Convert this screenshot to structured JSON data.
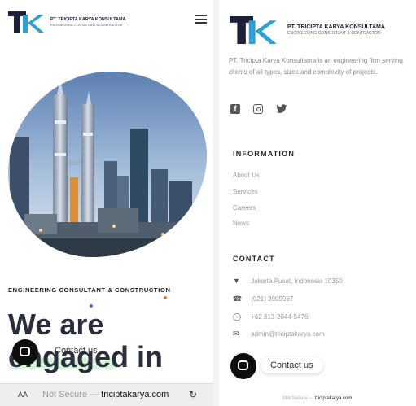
{
  "left": {
    "logo": {
      "mark": "TK",
      "brand": "PT. TRICIPTA KARYA KONSULTAMA",
      "tagline": "ENGINEERING CONSULTANT & CONTRACTOR"
    },
    "hero": {
      "subtitle": "ENGINEERING CONSULTANT & CONSTRUCTION",
      "headline_line1": "We are",
      "headline_line2": "engaged in"
    },
    "chat": {
      "label": "Contact us"
    },
    "address_bar": {
      "text_size": "AA",
      "security": "Not Secure",
      "separator": "—",
      "domain": "triciptakarya.com",
      "reload_icon": "reload-icon"
    }
  },
  "right": {
    "logo": {
      "mark": "TK",
      "brand": "PT. TRICIPTA KARYA KONSULTAMA",
      "tagline": "ENGINEERING CONSULTANT & CONTRACTOR"
    },
    "description": "PT. Tricipta Karya Konsultama is an engineering firm serving clients of all types, sizes and complexity of projects.",
    "social": [
      "facebook-icon",
      "instagram-icon",
      "twitter-icon"
    ],
    "information": {
      "title": "INFORMATION",
      "links": [
        "About Us",
        "Services",
        "Careers",
        "News"
      ]
    },
    "contact": {
      "title": "CONTACT",
      "address": "Jakarta Pusat, Indonesia 10350",
      "phone": "(021) 3905967",
      "whatsapp": "+62 813-2044-5476",
      "email": "admin@triciptakarya.com"
    },
    "chat": {
      "label": "Contact us"
    },
    "address_bar": {
      "security": "Not Secure",
      "separator": "—",
      "domain": "triciptakarya.com"
    }
  },
  "colors": {
    "brand_navy": "#1b2038",
    "brand_blue": "#2a9fd8",
    "chat_dark": "#0e0e0e",
    "accent_highlight": "#c9f2d0"
  }
}
